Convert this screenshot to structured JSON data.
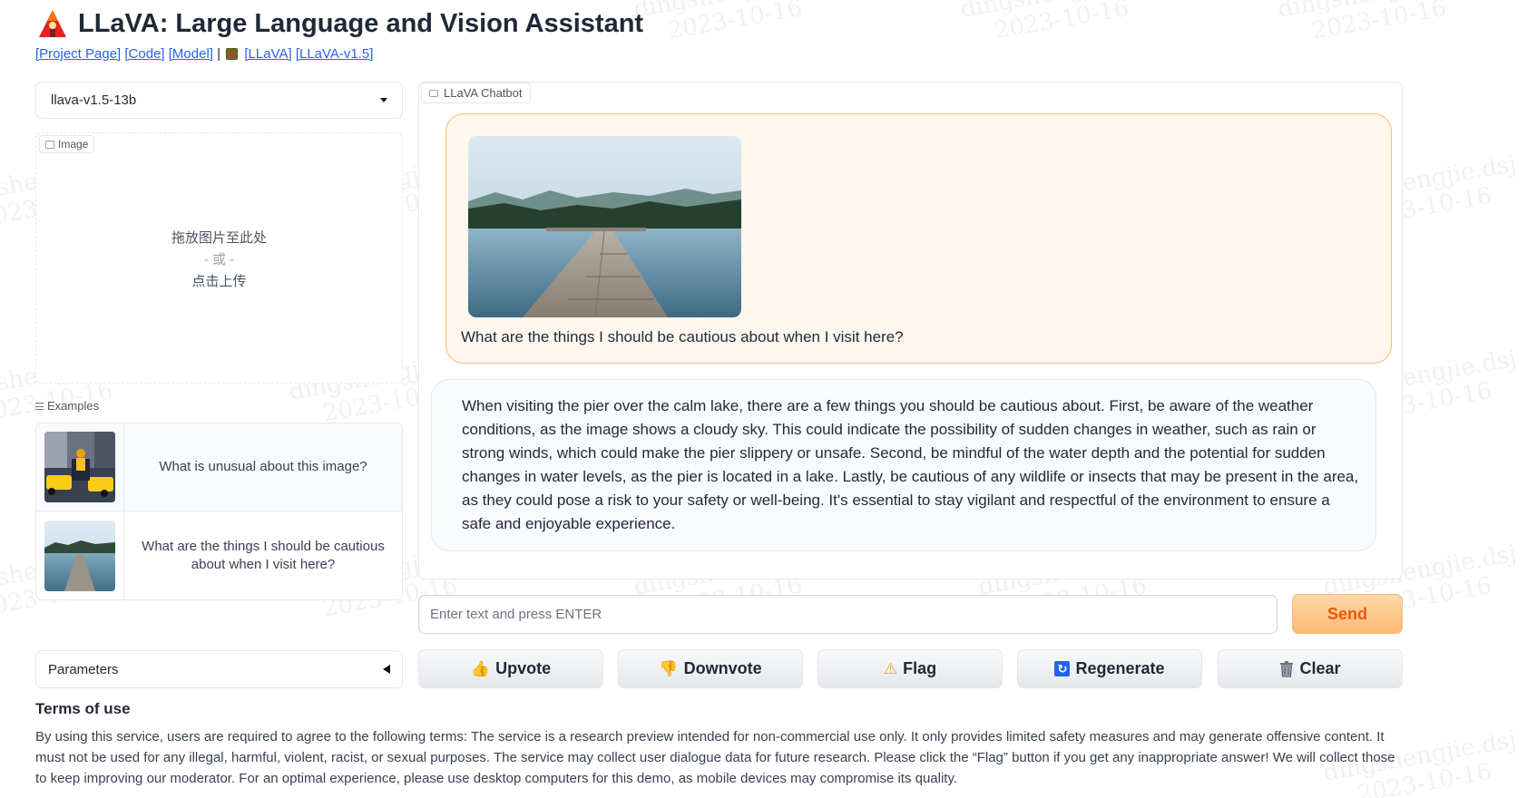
{
  "header": {
    "title": "LLaVA: Large Language and Vision Assistant",
    "links": [
      "[Project Page]",
      "[Code]",
      "[Model]",
      "[LLaVA]",
      "[LLaVA-v1.5]"
    ],
    "separator": " | "
  },
  "model_selector": {
    "value": "llava-v1.5-13b"
  },
  "image_upload": {
    "label": "Image",
    "drop_text": "拖放图片至此处",
    "or_text": "- 或 -",
    "click_text": "点击上传"
  },
  "examples": {
    "label": "Examples",
    "items": [
      {
        "text": "What is unusual about this image?"
      },
      {
        "text": "What are the things I should be cautious about when I visit here?"
      }
    ]
  },
  "parameters": {
    "label": "Parameters"
  },
  "chatbot": {
    "label": "LLaVA Chatbot",
    "messages": [
      {
        "role": "user",
        "text": "What are the things I should be cautious about when I visit here?"
      },
      {
        "role": "assistant",
        "text": "When visiting the pier over the calm lake, there are a few things you should be cautious about. First, be aware of the weather conditions, as the image shows a cloudy sky. This could indicate the possibility of sudden changes in weather, such as rain or strong winds, which could make the pier slippery or unsafe. Second, be mindful of the water depth and the potential for sudden changes in water levels, as the pier is located in a lake. Lastly, be cautious of any wildlife or insects that may be present in the area, as they could pose a risk to your safety or well-being. It's essential to stay vigilant and respectful of the environment to ensure a safe and enjoyable experience."
      }
    ]
  },
  "input": {
    "placeholder": "Enter text and press ENTER",
    "value": ""
  },
  "buttons": {
    "send": "Send",
    "upvote": "Upvote",
    "downvote": "Downvote",
    "flag": "Flag",
    "regenerate": "Regenerate",
    "clear": "Clear"
  },
  "terms": {
    "title": "Terms of use",
    "body": "By using this service, users are required to agree to the following terms: The service is a research preview intended for non-commercial use only. It only provides limited safety measures and may generate offensive content. It must not be used for any illegal, harmful, violent, racist, or sexual purposes. The service may collect user dialogue data for future research. Please click the “Flag” button if you get any inappropriate answer! We will collect those to keep improving our moderator. For an optimal experience, please use desktop computers for this demo, as mobile devices may compromise its quality."
  },
  "watermark": {
    "line1": "dingshengjie.dsj",
    "line2": "2023-10-16"
  },
  "colors": {
    "accent": "#f97316",
    "user_bubble": "#fff7ed",
    "user_border": "#fdba74",
    "link": "#2563eb"
  }
}
